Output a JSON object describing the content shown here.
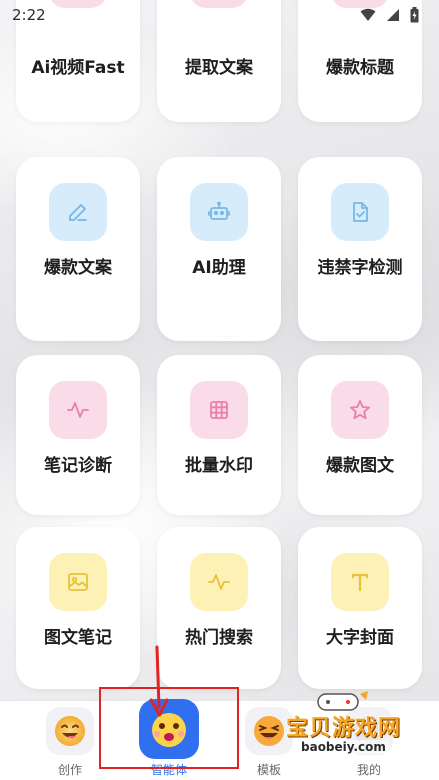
{
  "status_bar": {
    "time": "2:22",
    "icons": [
      "wifi-icon",
      "signal-icon",
      "battery-icon"
    ]
  },
  "tools": [
    {
      "label": "Ai视频Fast",
      "icon": "",
      "tint": "pink"
    },
    {
      "label": "提取文案",
      "icon": "",
      "tint": "pink"
    },
    {
      "label": "爆款标题",
      "icon": "",
      "tint": "pink"
    },
    {
      "label": "爆款文案",
      "icon": "pencil-icon",
      "tint": "blue"
    },
    {
      "label": "AI助理",
      "icon": "robot-icon",
      "tint": "blue"
    },
    {
      "label": "违禁字检测",
      "icon": "document-check-icon",
      "tint": "blue"
    },
    {
      "label": "笔记诊断",
      "icon": "pulse-icon",
      "tint": "pink"
    },
    {
      "label": "批量水印",
      "icon": "grid-icon",
      "tint": "pink"
    },
    {
      "label": "爆款图文",
      "icon": "star-icon",
      "tint": "pink"
    },
    {
      "label": "图文笔记",
      "icon": "image-icon",
      "tint": "yellow"
    },
    {
      "label": "热门搜索",
      "icon": "pulse-icon",
      "tint": "yellow"
    },
    {
      "label": "大字封面",
      "icon": "text-t-icon",
      "tint": "yellow"
    }
  ],
  "tabbar": {
    "tabs": [
      {
        "label": "创作",
        "icon": "smiley-face-icon"
      },
      {
        "label": "智能体",
        "icon": "agent-face-icon"
      },
      {
        "label": "模板",
        "icon": "laughing-face-icon"
      },
      {
        "label": "我的",
        "icon": "profile-icon"
      }
    ]
  },
  "watermark": {
    "text": "宝贝游戏网",
    "url": "baobeiy.com"
  },
  "colors": {
    "tint_blue": "#d7ecfb",
    "tint_pink": "#fadbe8",
    "tint_yellow": "#fdf1b5",
    "highlight": "#e32222"
  }
}
